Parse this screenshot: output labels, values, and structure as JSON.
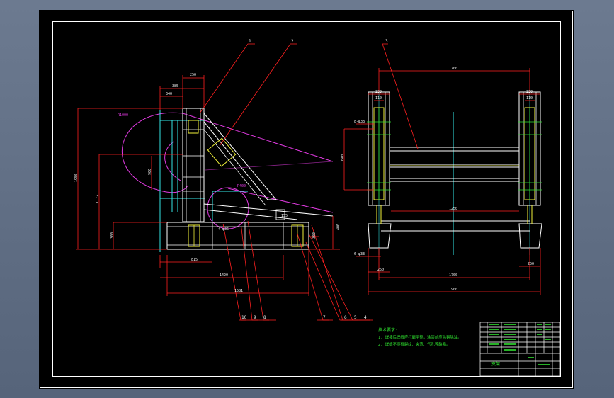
{
  "colors": {
    "background": "#5d6b82",
    "sheet": "#000000",
    "frame": "#ffffff",
    "leader": "#ff2020",
    "structure": "#ffffff",
    "cyan": "#35e6e6",
    "magenta": "#e23ae2",
    "yellow": "#f2f23a",
    "green": "#2fe02f"
  },
  "callouts": {
    "c1": "1",
    "c2": "2",
    "c3": "3",
    "c4": "4",
    "c5": "5",
    "c6": "6",
    "c7": "7",
    "c8": "8",
    "c9": "9",
    "c10": "10"
  },
  "side_view": {
    "dim_top_250": "250",
    "dim_385": "385",
    "dim_340": "340",
    "dim_r1000": "R1000",
    "dim_1950": "1950",
    "dim_1172": "1172",
    "dim_900": "900",
    "dim_400": "400",
    "dim_r400": "R400",
    "dim_4_m20": "4-φ36",
    "dim_300_left": "300",
    "dim_300_right": "300",
    "dim_155": "155",
    "dim_815": "815",
    "dim_1420": "1420",
    "dim_1581": "1581"
  },
  "front_view": {
    "dim_1700_top": "1700",
    "dim_230_left": "230",
    "dim_110_left": "110",
    "dim_230_right": "230",
    "dim_110_right": "110",
    "dim_8_m20": "8-φ38",
    "dim_640": "640",
    "dim_1250": "1250",
    "dim_6_m20": "6-φ33",
    "dim_250_left": "250",
    "dim_250_right": "250",
    "dim_1700_bottom": "1700",
    "dim_1900": "1900"
  },
  "notes": {
    "title": "技术要求:",
    "line1": "1. 焊接后焊缝应打磨平整，涂漆前应除锈除油。",
    "line2": "2. 焊缝不得有裂纹、夹渣、气孔等缺陷。"
  },
  "title_block": {
    "name": "支架"
  }
}
